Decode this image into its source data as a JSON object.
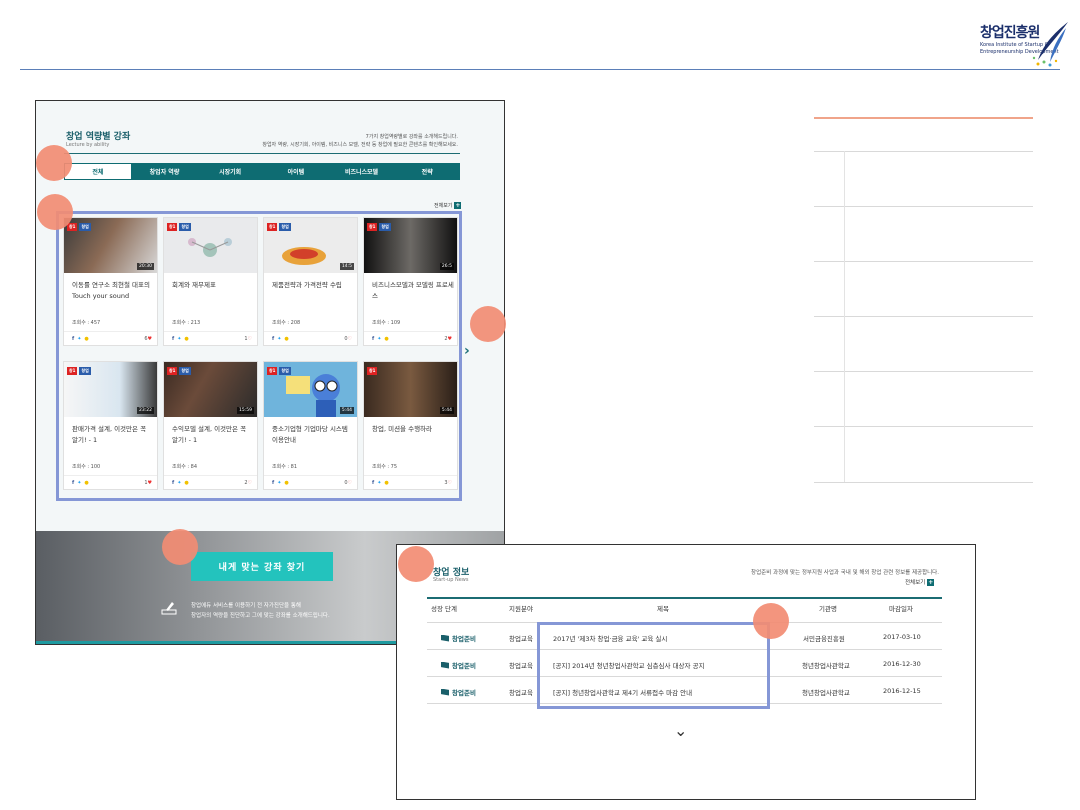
{
  "brand": {
    "logo_kr": "창업진흥원",
    "logo_en_line1": "Korea Institute of Startup &",
    "logo_en_line2": "Entrepreneurship Development"
  },
  "lecture_panel": {
    "title": "창업 역량별 강좌",
    "subtitle": "Lecture by ability",
    "desc_line1": "7가지 창업역량별로 강좌를 소개해드립니다.",
    "desc_line2": "창업자 역량, 시장기회, 아이템, 비즈니스 모델, 전략 등 창업에 필요한 콘텐츠를 확인해보세요.",
    "tabs": [
      "전체",
      "창업자 역량",
      "시장기회",
      "아이템",
      "비즈니스모델",
      "전략"
    ],
    "more_label": "전체보기",
    "cards": [
      {
        "title": "이동률 연구소 최현철 대표의 Touch your sound",
        "views": "조회수 : 457",
        "likes": "6",
        "duration": "20:30",
        "badge1": "창1",
        "badge2": "창업"
      },
      {
        "title": "회계와 재무제표",
        "views": "조회수 : 213",
        "likes": "1",
        "duration": "",
        "badge1": "창1",
        "badge2": "창업"
      },
      {
        "title": "제품전략과 가격전략 수립",
        "views": "조회수 : 208",
        "likes": "0",
        "duration": "14:5",
        "badge1": "창1",
        "badge2": "창업"
      },
      {
        "title": "비즈니스모델과 모델링 프로세스",
        "views": "조회수 : 109",
        "likes": "2",
        "duration": "26:5",
        "badge1": "창1",
        "badge2": "창업"
      },
      {
        "title": "판매가격 설계, 이것만은 꼭 알기! - 1",
        "views": "조회수 : 100",
        "likes": "1",
        "duration": "23:22",
        "badge1": "창1",
        "badge2": "창업"
      },
      {
        "title": "수익모델 설계, 이것만은 꼭 알기! - 1",
        "views": "조회수 : 84",
        "likes": "2",
        "duration": "15:59",
        "badge1": "창1",
        "badge2": "창업"
      },
      {
        "title": "중소기업형 기업마당 시스템 이용안내",
        "views": "조회수 : 81",
        "likes": "0",
        "duration": "5:44",
        "badge1": "창1",
        "badge2": "창업"
      },
      {
        "title": "창업, 미션을 수행하라",
        "views": "조회수 : 75",
        "likes": "3",
        "duration": "5:44",
        "badge1": "창1",
        "badge2": "창업"
      }
    ],
    "banner_button": "내게 맞는 강좌 찾기",
    "banner_line1": "창업에듀 서비스를 이용하기 전 자가진단을 통해",
    "banner_line2": "창업자의 역량을 진단하고 그에 맞는 강좌를 소개해드립니다."
  },
  "news_panel": {
    "title": "창업 정보",
    "subtitle": "Start-up News",
    "desc": "창업준비 과정에 맞는 정부지원 사업과 국내 및 해외 창업 관련 정보를 제공합니다.",
    "more_label": "전체보기",
    "columns": [
      "성장 단계",
      "지원분야",
      "제목",
      "기관명",
      "마감일자"
    ],
    "rows": [
      {
        "stage": "창업준비",
        "field": "창업교육",
        "title": "2017년 '제3차 창업·금융 교육' 교육 실시",
        "org": "서민금융진흥원",
        "deadline": "2017-03-10"
      },
      {
        "stage": "창업준비",
        "field": "창업교육",
        "title": "[공지] 2014년 청년창업사관학교 심층심사 대상자 공지",
        "org": "청년창업사관학교",
        "deadline": "2016-12-30"
      },
      {
        "stage": "창업준비",
        "field": "창업교육",
        "title": "[공지] 청년창업사관학교 제4기 서류접수 마감 안내",
        "org": "청년창업사관학교",
        "deadline": "2016-12-15"
      }
    ]
  }
}
